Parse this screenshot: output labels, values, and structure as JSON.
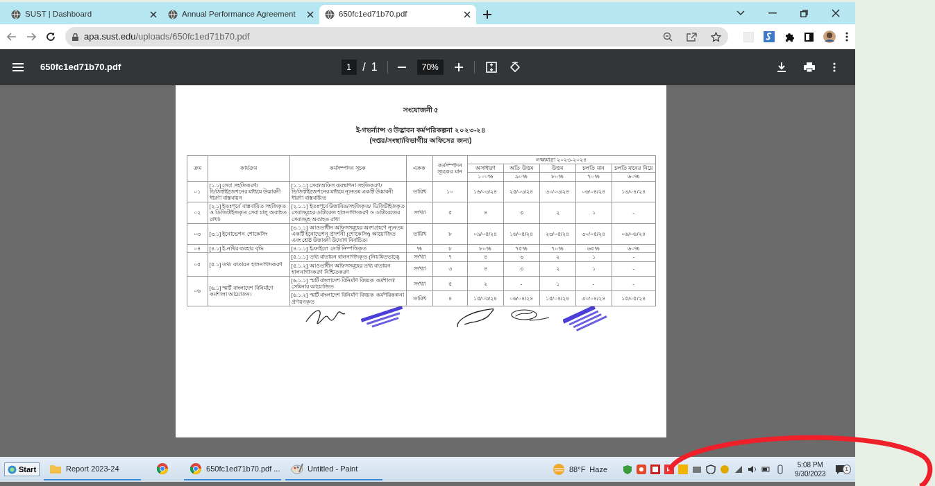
{
  "browser": {
    "tabs": [
      {
        "title": "SUST | Dashboard",
        "selected": false
      },
      {
        "title": "Annual Performance Agreement",
        "selected": false
      },
      {
        "title": "650fc1ed71b70.pdf",
        "selected": true
      }
    ],
    "address": {
      "host": "apa.sust.edu",
      "path": "/uploads/650fc1ed71b70.pdf"
    }
  },
  "pdf_toolbar": {
    "filename": "650fc1ed71b70.pdf",
    "page": "1",
    "page_separator": "/",
    "page_count": "1",
    "zoom": "70%"
  },
  "document": {
    "annex": "সংযোজনী ৫",
    "title": "ই-গভর্ন্যান্স ও উদ্ভাবন কর্মপরিকল্পনা ২০২৩-২৪",
    "subtitle": "(দপ্তর/সংস্থা/বিভাগীয় অফিসের জন্য)",
    "table": {
      "columns": [
        "ক্রম",
        "কার্যক্রম",
        "কর্মসম্পাদন সূচক",
        "একক",
        "কর্মসম্পাদন সূচকের মান"
      ],
      "target_header": "লক্ষ্যমাত্রা ২০২৩-২০২৪",
      "target_levels": [
        "অসাধারণ",
        "অতি উত্তম",
        "উত্তম",
        "চলতি মান",
        "চলতি মানের নিম্নে"
      ],
      "target_percents": [
        "১০০%",
        "৯০%",
        "৮০%",
        "৭০%",
        "৬০%"
      ],
      "groups": [
        {
          "serial": "০১",
          "activity": "[১.১] সেবা সহজিকরণ/ ডিজিটাইজেশনের মাধ্যমে উদ্ভাবনী ধারণা বাস্তবায়ন",
          "indicators": [
            {
              "indicator": "[১.১.১] সেবা/অফিস ব্যবস্থাপনা সহজিকরণ/ডিজিটাইজেশনের মাধ্যমে ন্যূনতম একটি উদ্ভাবনী ধারণা বাস্তবায়িত",
              "unit": "তারিখ",
              "weight": "১০",
              "targets": [
                "১৬/০৩/২৪",
                "২৫/০৩/২৪",
                "৩০/০৩/২৪",
                "০৬/০৪/২৪",
                "১৩/০৪/২৪"
              ]
            }
          ]
        },
        {
          "serial": "০২",
          "activity": "[২.১] ইতঃপূর্বে বাস্তবায়িত সহজিকৃত ও ডিজিটাইজকৃত সেবা চালু অব্যাহত রাখা।",
          "indicators": [
            {
              "indicator": "[২.১.১] ইতঃপূর্বে উদ্ভাবিত/সহজিকৃত/ ডিজিটাইজকৃত সেবাসমূহের ডাটাবেজ হালনাগাদকরণ ও ডাটাবেজের সেবাসমূহ অব্যাহত রাখা",
              "unit": "সংখ্যা",
              "weight": "৫",
              "targets": [
                "৪",
                "৩",
                "২",
                "১",
                "-"
              ]
            }
          ]
        },
        {
          "serial": "০৩",
          "activity": "[৩.১] ইনোভেশন শোকেসিং",
          "indicators": [
            {
              "indicator": "[৩.১.১] আওতাধীন অফিসসমূহের অংশগ্রহণে ন্যূনতম একটি ইনোভেশন প্রদর্শনী (শোকেসিং) আয়োজিত এবং শ্রেষ্ঠ উদ্ভাবনী উদ্যোগ নির্বাচিত।",
              "unit": "তারিখ",
              "weight": "৮",
              "targets": [
                "০৯/০৫/২৪",
                "১৬/০৫/২৪",
                "২৩/০৫/২৪",
                "৩০/০৫/২৪",
                "০৬/০৬/২৪"
              ]
            }
          ]
        },
        {
          "serial": "০৪",
          "activity": "[৪.১] ই-নথির ব্যবহার বৃদ্ধি",
          "indicators": [
            {
              "indicator": "[৪.১.১] ই-ফাইলে নোট নিষ্পত্তিকৃত",
              "unit": "%",
              "weight": "৮",
              "targets": [
                "৮০%",
                "৭৫%",
                "৭০%",
                "৬৫%",
                "৬০%"
              ]
            }
          ]
        },
        {
          "serial": "০৫",
          "activity": "[৫.১] তথ্য বাতায়ন হালনাগাদকরণ",
          "indicators": [
            {
              "indicator": "[৫.১.১] তথ্য বাতায়ন হালনাগাদকৃত (নিয়মিতভাবে)",
              "unit": "সংখ্যা",
              "weight": "৭",
              "targets": [
                "৪",
                "৩",
                "২",
                "১",
                "-"
              ]
            },
            {
              "indicator": "[৫.১.২] আওতাধীন অফিসসমূহের তথ্য বাতায়ন হালনাগাদকরণ নিশ্চিতকরণ",
              "unit": "সংখ্যা",
              "weight": "৩",
              "targets": [
                "৪",
                "৩",
                "২",
                "১",
                "-"
              ]
            }
          ]
        },
        {
          "serial": "০৬",
          "activity": "[৬.১] স্মার্ট বাংলাদেশ বিনির্মাণে কর্মশালা আয়োজন।",
          "indicators": [
            {
              "indicator": "[৬.১.১] স্মার্ট বাংলাদেশ বিনির্মাণ বিষয়ক কর্মশালা/সেমিনার আয়োজিত",
              "unit": "সংখ্যা",
              "weight": "৫",
              "targets": [
                "২",
                "-",
                "১",
                "-",
                "-"
              ]
            },
            {
              "indicator": "[৬.১.২] স্মার্ট বাংলাদেশ বিনির্মাণ বিষয়ক কর্মপরিকল্পনা প্রণয়নকৃত",
              "unit": "তারিখ",
              "weight": "৪",
              "targets": [
                "১৫/০৩/২৪",
                "০৬/০৪/২৪",
                "১৫/০৪/২৪",
                "৩০/০৪/২৪",
                "১৫/০৫/২৪"
              ]
            }
          ]
        }
      ]
    }
  },
  "taskbar": {
    "start": "Start",
    "apps": [
      {
        "kind": "folder",
        "label": "Report 2023-24",
        "running": true
      },
      {
        "kind": "browser",
        "running": false
      },
      {
        "kind": "browser",
        "label": "650fc1ed71b70.pdf ...",
        "running": true
      },
      {
        "kind": "paint",
        "label": "Untitled - Paint",
        "running": true
      }
    ],
    "weather": {
      "temperature": "88°F",
      "condition": "Haze"
    },
    "clock": {
      "time": "5:08 PM",
      "date": "9/30/2023"
    },
    "notifications": "1"
  }
}
